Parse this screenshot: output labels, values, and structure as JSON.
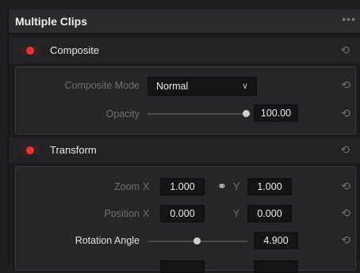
{
  "panel": {
    "title": "Multiple Clips",
    "more_label": "•••"
  },
  "composite": {
    "title": "Composite",
    "enabled": true,
    "mode_label": "Composite Mode",
    "mode_value": "Normal",
    "opacity_label": "Opacity",
    "opacity_value": "100.00",
    "opacity_fraction": 1.0
  },
  "transform": {
    "title": "Transform",
    "enabled": true,
    "zoom": {
      "label": "Zoom",
      "x_axis": "X",
      "x_value": "1.000",
      "y_axis": "Y",
      "y_value": "1.000"
    },
    "position": {
      "label": "Position",
      "x_axis": "X",
      "x_value": "0.000",
      "y_axis": "Y",
      "y_value": "0.000"
    },
    "rotation": {
      "label": "Rotation Angle",
      "value": "4.900",
      "fraction": 0.5
    }
  },
  "icons": {
    "reset": "⟲",
    "chevron": "∨",
    "link": "⚭"
  },
  "colors": {
    "toggle_on": "#e0363a",
    "accent": "#e0363a"
  }
}
